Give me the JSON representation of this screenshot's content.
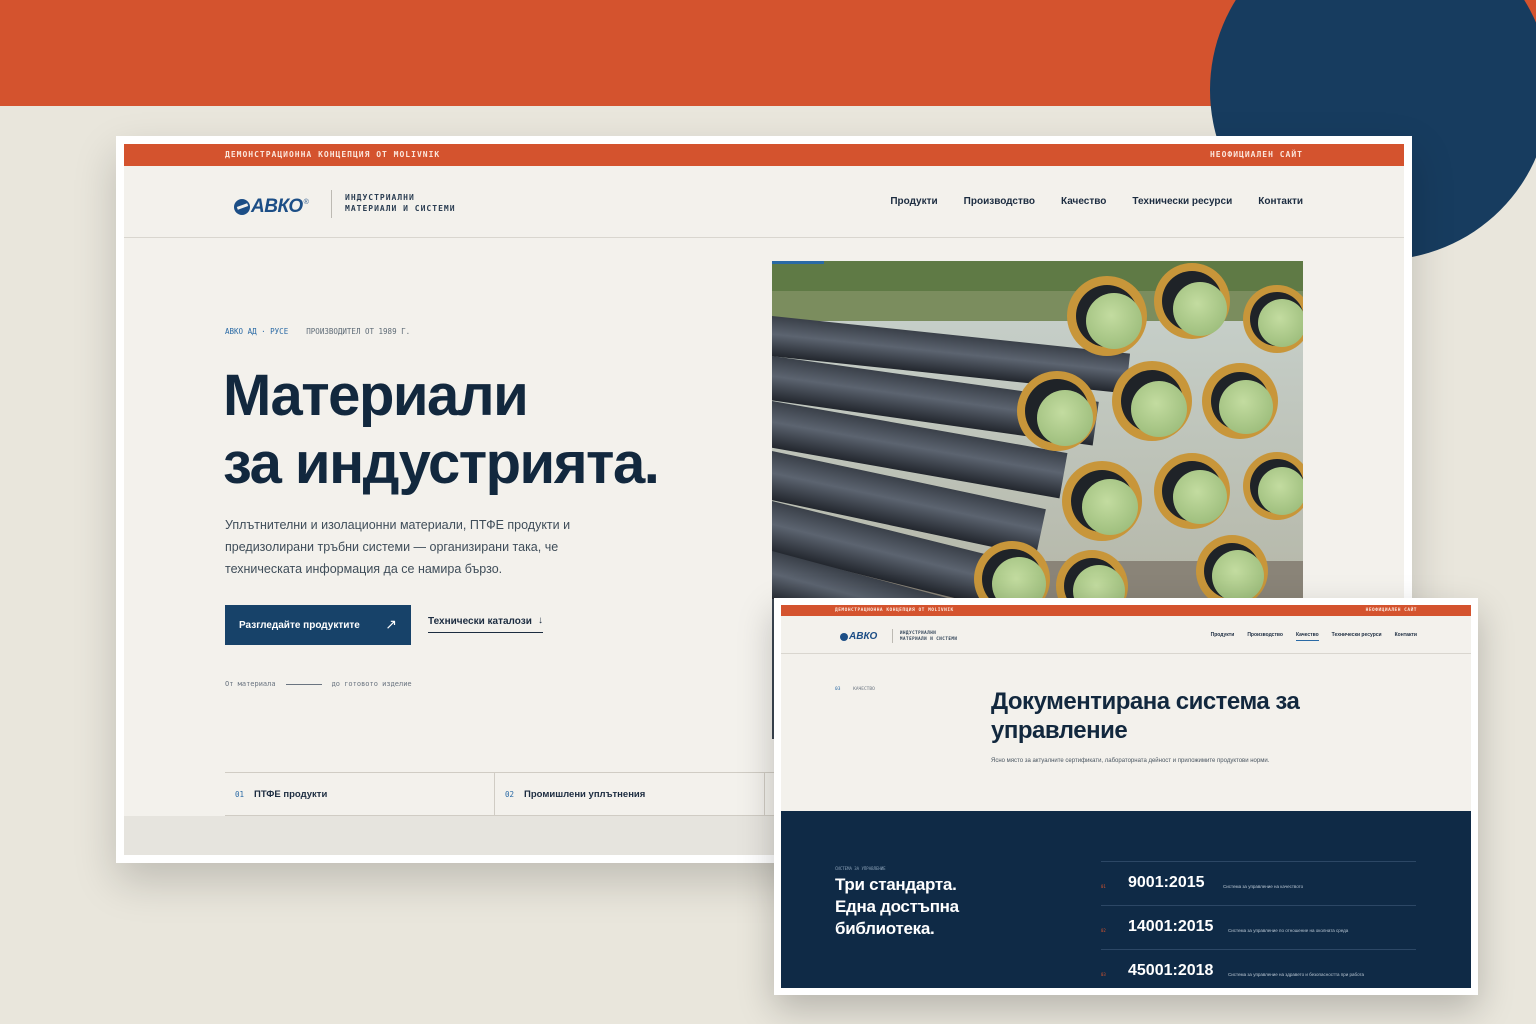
{
  "colors": {
    "accent": "#d4532e",
    "navy": "#173c5f",
    "dark_section": "#0f2a46",
    "bg": "#f3f1ec"
  },
  "site": {
    "topbar_left": "ДЕМОНСТРАЦИОННА КОНЦЕПЦИЯ ОТ MOLIVNIK",
    "topbar_right": "НЕОФИЦИАЛЕН САЙТ",
    "logo_text": "АВКО",
    "logo_reg": "®",
    "tagline_1": "ИНДУСТРИАЛНИ",
    "tagline_2": "МАТЕРИАЛИ И СИСТЕМИ",
    "nav": [
      "Продукти",
      "Производство",
      "Качество",
      "Технически ресурси",
      "Контакти"
    ]
  },
  "hero": {
    "eyebrow_company": "АВКО АД · РУСЕ",
    "eyebrow_since": "ПРОИЗВОДИТЕЛ ОТ 1989 Г.",
    "title_line1": "Материали",
    "title_line2": "за индустрията.",
    "description": "Уплътнителни и изолационни материали, ПТФЕ продукти и предизолирани тръбни системи — организирани така, че техническата информация да се намира бързо.",
    "primary_button": "Разгледайте продуктите",
    "primary_button_icon": "arrow-up-right-icon",
    "secondary_button": "Технически каталози",
    "secondary_button_icon": "arrow-down-icon",
    "process_from": "От материала",
    "process_to": "до готовото изделие",
    "image_alt": "pre-insulated-pipes-photo"
  },
  "tiles": [
    {
      "num": "01",
      "label": "ПТФЕ продукти"
    },
    {
      "num": "02",
      "label": "Промишлени уплътнения"
    }
  ],
  "quality_page": {
    "active_nav": "Качество",
    "eyebrow_num": "03",
    "eyebrow_label": "КАЧЕСТВО",
    "title_line1": "Документирана система за",
    "title_line2": "управление",
    "description": "Ясно място за актуалните сертификати, лабораторната дейност и приложимите продуктови норми.",
    "dark_eyebrow": "СИСТЕМА ЗА УПРАВЛЕНИЕ",
    "dark_line1": "Три стандарта.",
    "dark_line2": "Една достъпна",
    "dark_line3": "библиотека.",
    "standards": [
      {
        "idx": "01",
        "code": "9001:2015",
        "desc": "Система за управление на качеството"
      },
      {
        "idx": "02",
        "code": "14001:2015",
        "desc": "Система за управление по отношение на околната среда"
      },
      {
        "idx": "03",
        "code": "45001:2018",
        "desc": "Система за управление на здравето и безопасността при работа"
      }
    ]
  }
}
